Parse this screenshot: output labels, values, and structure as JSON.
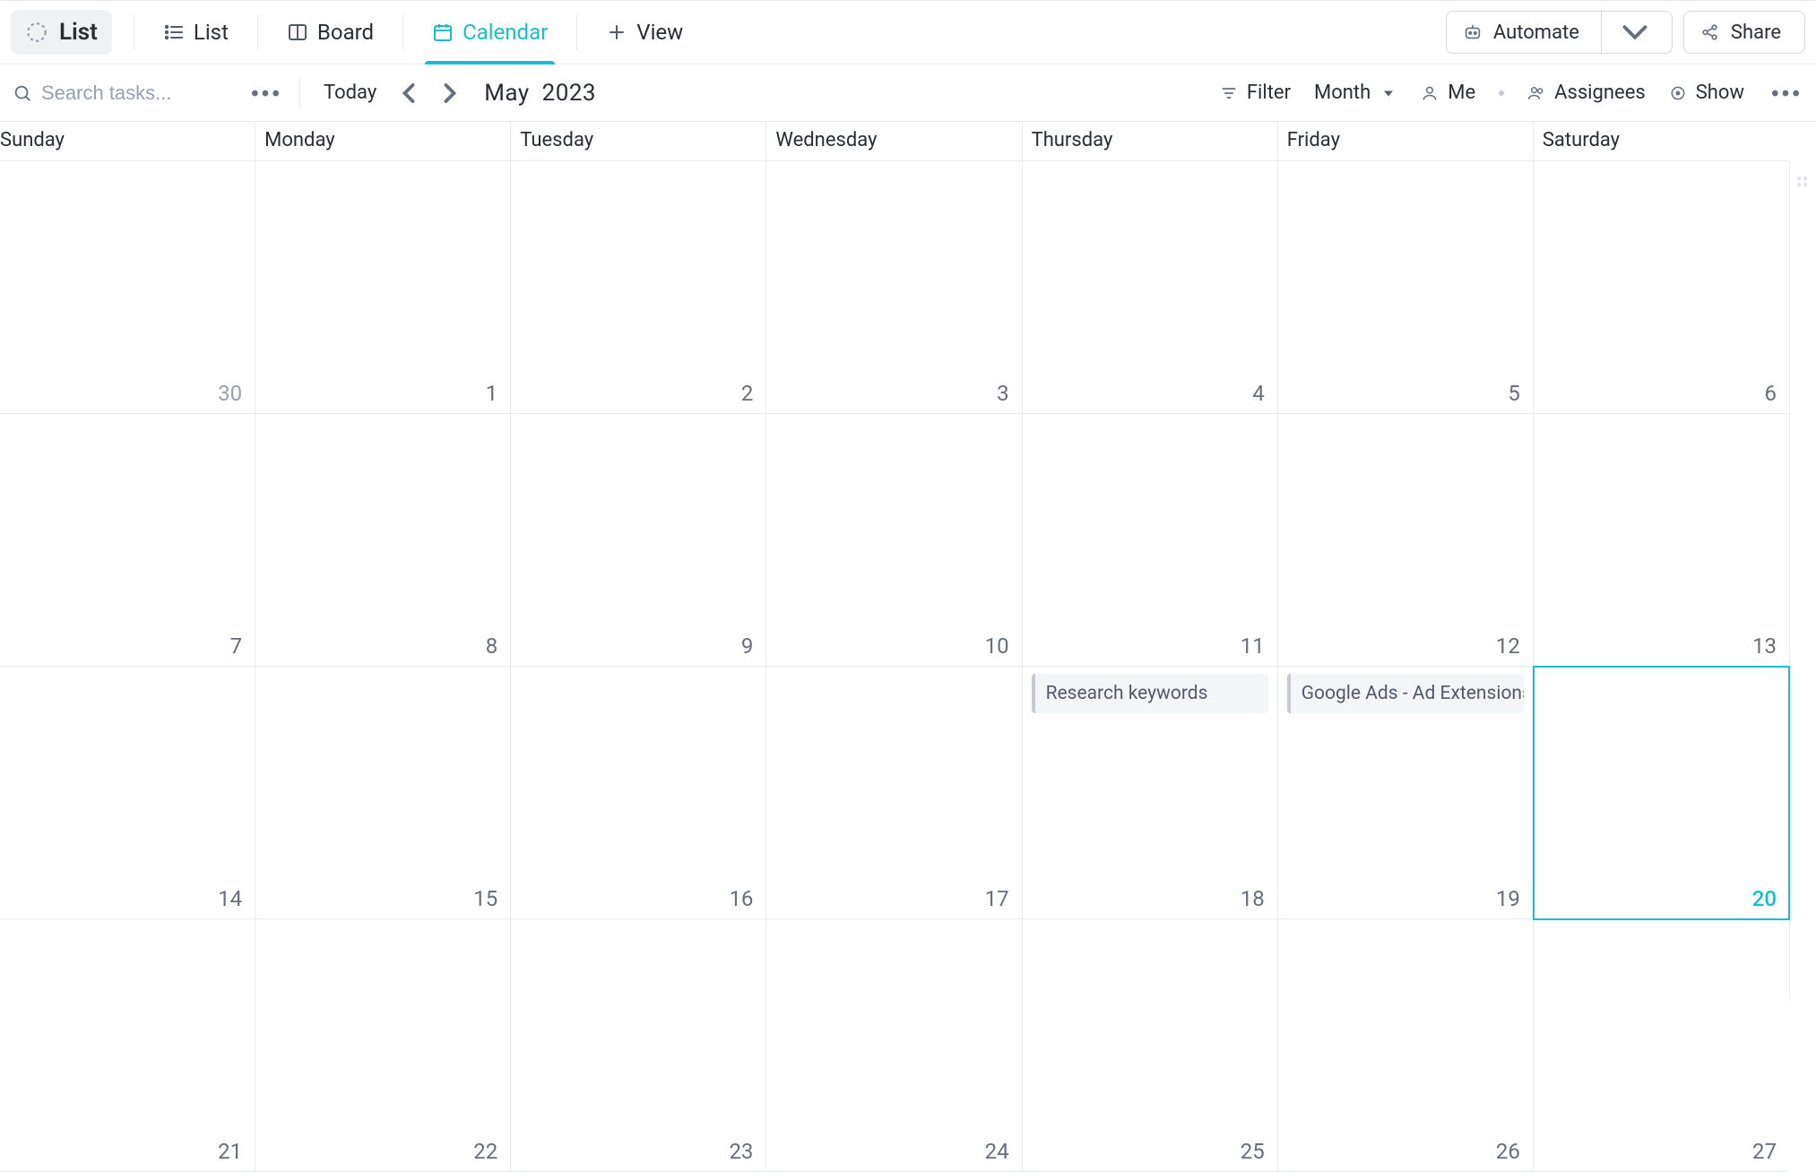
{
  "header": {
    "list_label": "List",
    "views": {
      "list": "List",
      "board": "Board",
      "calendar": "Calendar",
      "add_view": "View"
    },
    "automate_label": "Automate",
    "share_label": "Share"
  },
  "filterbar": {
    "search_placeholder": "Search tasks...",
    "today_label": "Today",
    "month_label": "May",
    "year_label": "2023",
    "filter_label": "Filter",
    "range_label": "Month",
    "me_label": "Me",
    "assignees_label": "Assignees",
    "show_label": "Show"
  },
  "calendar": {
    "weekdays": [
      "Sunday",
      "Monday",
      "Tuesday",
      "Wednesday",
      "Thursday",
      "Friday",
      "Saturday"
    ],
    "weeks": [
      {
        "days": [
          {
            "num": 30,
            "muted": true
          },
          {
            "num": 1
          },
          {
            "num": 2
          },
          {
            "num": 3
          },
          {
            "num": 4
          },
          {
            "num": 5
          },
          {
            "num": 6
          }
        ]
      },
      {
        "days": [
          {
            "num": 7
          },
          {
            "num": 8
          },
          {
            "num": 9
          },
          {
            "num": 10
          },
          {
            "num": 11
          },
          {
            "num": 12
          },
          {
            "num": 13
          }
        ]
      },
      {
        "days": [
          {
            "num": 14
          },
          {
            "num": 15
          },
          {
            "num": 16
          },
          {
            "num": 17
          },
          {
            "num": 18,
            "task": "Research keywords"
          },
          {
            "num": 19,
            "task": "Google Ads - Ad Extensions"
          },
          {
            "num": 20,
            "today": true
          }
        ]
      },
      {
        "days": [
          {
            "num": 21
          },
          {
            "num": 22
          },
          {
            "num": 23
          },
          {
            "num": 24
          },
          {
            "num": 25
          },
          {
            "num": 26
          },
          {
            "num": 27
          }
        ]
      }
    ]
  }
}
